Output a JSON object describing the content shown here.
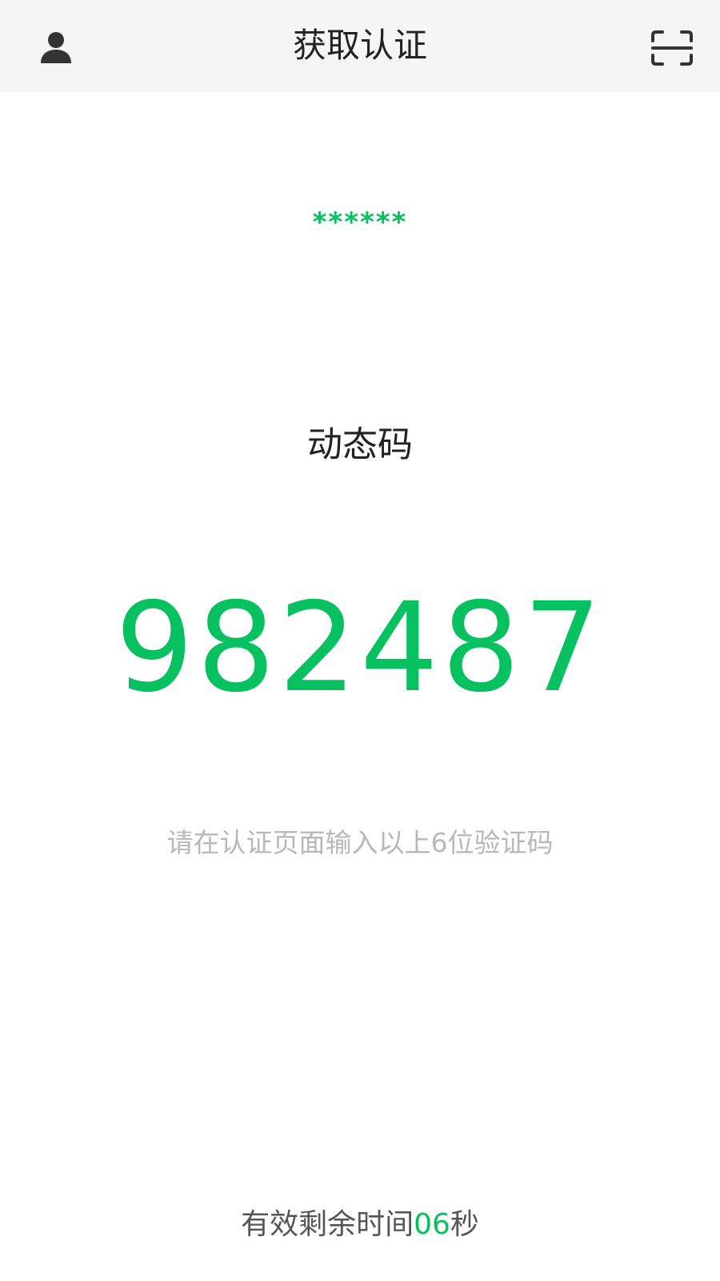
{
  "header": {
    "title": "获取认证",
    "left_icon": "user-icon",
    "right_icon": "scan-icon"
  },
  "account": {
    "masked": "******"
  },
  "code": {
    "label": "动态码",
    "value": "982487"
  },
  "hint": "请在认证页面输入以上6位验证码",
  "countdown": {
    "prefix": "有效剩余时间",
    "seconds": "06",
    "suffix": "秒"
  },
  "colors": {
    "accent": "#07c160",
    "header_bg": "#f5f5f5",
    "text_primary": "#222222",
    "text_hint": "#b8b8b8",
    "text_secondary": "#555555"
  }
}
